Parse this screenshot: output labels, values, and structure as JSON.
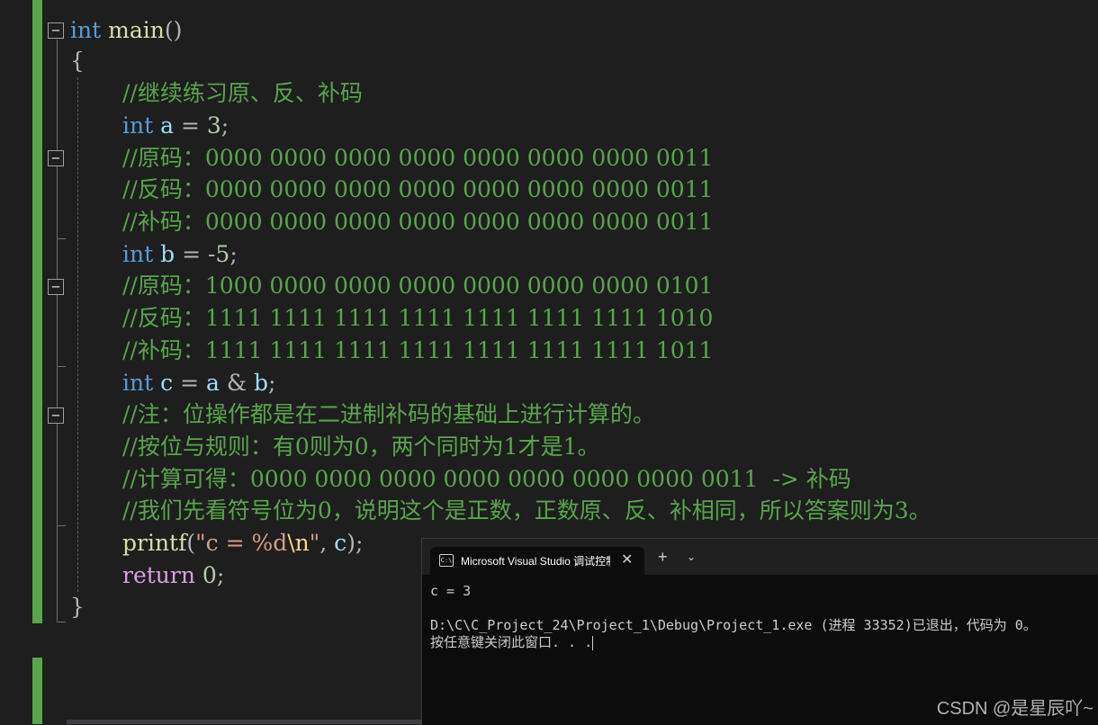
{
  "editor": {
    "lines": {
      "l1_kw": "int",
      "l1_fn": "main",
      "l1_paren": "()",
      "l2": "{",
      "l3": "//继续练习原、反、补码",
      "l4_kw": "int",
      "l4_var": "a",
      "l4_op": " = ",
      "l4_num": "3",
      "l4_end": ";",
      "l5": "//原码：0000 0000 0000 0000 0000 0000 0000 0011",
      "l6": "//反码：0000 0000 0000 0000 0000 0000 0000 0011",
      "l7": "//补码：0000 0000 0000 0000 0000 0000 0000 0011",
      "l8_kw": "int",
      "l8_var": "b",
      "l8_op": " = -",
      "l8_num": "5",
      "l8_end": ";",
      "l9": "//原码：1000 0000 0000 0000 0000 0000 0000 0101",
      "l10": "//反码：1111 1111 1111 1111 1111 1111 1111 1010",
      "l11": "//补码：1111 1111 1111 1111 1111 1111 1111 1011",
      "l12_kw": "int",
      "l12_var": "c",
      "l12_op1": " = ",
      "l12_var2": "a",
      "l12_op2": " & ",
      "l12_var3": "b",
      "l12_end": ";",
      "l13": "//注：位操作都是在二进制补码的基础上进行计算的。",
      "l14": "//按位与规则：有0则为0，两个同时为1才是1。",
      "l15": "//计算可得：0000 0000 0000 0000 0000 0000 0000 0011  -> 补码",
      "l16": "//我们先看符号位为0，说明这个是正数，正数原、反、补相同，所以答案则为3。",
      "l17_fn": "printf",
      "l17_open": "(",
      "l17_str1": "\"c = %d",
      "l17_esc": "\\n",
      "l17_str2": "\"",
      "l17_comma": ", ",
      "l17_var": "c",
      "l17_end": ");",
      "l18_kw": "return",
      "l18_num": " 0",
      "l18_end": ";",
      "l19": "}"
    }
  },
  "console": {
    "tab_title": "Microsoft Visual Studio 调试控制台",
    "tab_icon": "C:\\",
    "close": "✕",
    "new_tab": "+",
    "dropdown": "⌄",
    "output_line1": "c = 3",
    "output_line2": "D:\\C\\C_Project_24\\Project_1\\Debug\\Project_1.exe (进程 33352)已退出，代码为 0。",
    "output_line3": "按任意键关闭此窗口. . ."
  },
  "watermark": "CSDN @是星辰吖~",
  "colors": {
    "comment": "#57a64a",
    "keyword": "#569cd6",
    "function": "#dcdcaa",
    "variable": "#9cdcfe",
    "console_bg": "#0c0c0c"
  }
}
